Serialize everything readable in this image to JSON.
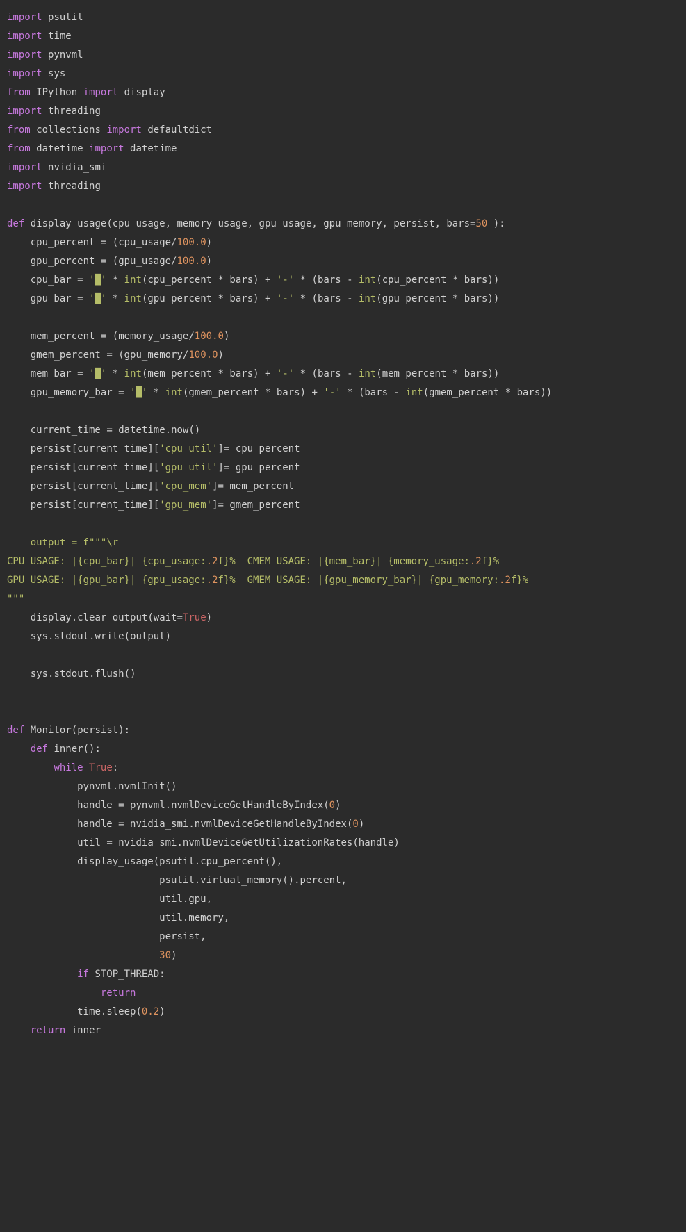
{
  "code": {
    "language": "python",
    "lines": [
      "import psutil",
      "import time",
      "import pynvml",
      "import sys",
      "from IPython import display",
      "import threading",
      "from collections import defaultdict",
      "from datetime import datetime",
      "import nvidia_smi",
      "import threading",
      "",
      "def display_usage(cpu_usage, memory_usage, gpu_usage, gpu_memory, persist, bars=50 ):",
      "    cpu_percent = (cpu_usage/100.0)",
      "    gpu_percent = (gpu_usage/100.0)",
      "    cpu_bar = '█' * int(cpu_percent * bars) + '-' * (bars - int(cpu_percent * bars))",
      "    gpu_bar = '█' * int(gpu_percent * bars) + '-' * (bars - int(gpu_percent * bars))",
      "",
      "    mem_percent = (memory_usage/100.0)",
      "    gmem_percent = (gpu_memory/100.0)",
      "    mem_bar = '█' * int(mem_percent * bars) + '-' * (bars - int(mem_percent * bars))",
      "    gpu_memory_bar = '█' * int(gmem_percent * bars) + '-' * (bars - int(gmem_percent * bars))",
      "",
      "    current_time = datetime.now()",
      "    persist[current_time]['cpu_util']= cpu_percent",
      "    persist[current_time]['gpu_util']= gpu_percent",
      "    persist[current_time]['cpu_mem']= mem_percent",
      "    persist[current_time]['gpu_mem']= gmem_percent",
      "",
      "    output = f\"\"\"\\r",
      "CPU USAGE: |{cpu_bar}| {cpu_usage:.2f}%  CMEM USAGE: |{mem_bar}| {memory_usage:.2f}%",
      "GPU USAGE: |{gpu_bar}| {gpu_usage:.2f}%  GMEM USAGE: |{gpu_memory_bar}| {gpu_memory:.2f}%",
      "\"\"\"",
      "    display.clear_output(wait=True)",
      "    sys.stdout.write(output)",
      "",
      "    sys.stdout.flush()",
      "",
      "",
      "def Monitor(persist):",
      "    def inner():",
      "        while True:",
      "            pynvml.nvmlInit()",
      "            handle = pynvml.nvmlDeviceGetHandleByIndex(0)",
      "            handle = nvidia_smi.nvmlDeviceGetHandleByIndex(0)",
      "            util = nvidia_smi.nvmlDeviceGetUtilizationRates(handle)",
      "            display_usage(psutil.cpu_percent(),",
      "                          psutil.virtual_memory().percent,",
      "                          util.gpu,",
      "                          util.memory,",
      "                          persist,",
      "                          30)",
      "            if STOP_THREAD:",
      "                return",
      "            time.sleep(0.2)",
      "    return inner"
    ]
  },
  "highlight": {
    "keywords_pink": [
      "import",
      "from",
      "def",
      "return",
      "if",
      "while"
    ],
    "bool_true": "True",
    "numbers": [
      "50",
      "100.0",
      "0",
      "30",
      "0.2",
      "2"
    ]
  }
}
